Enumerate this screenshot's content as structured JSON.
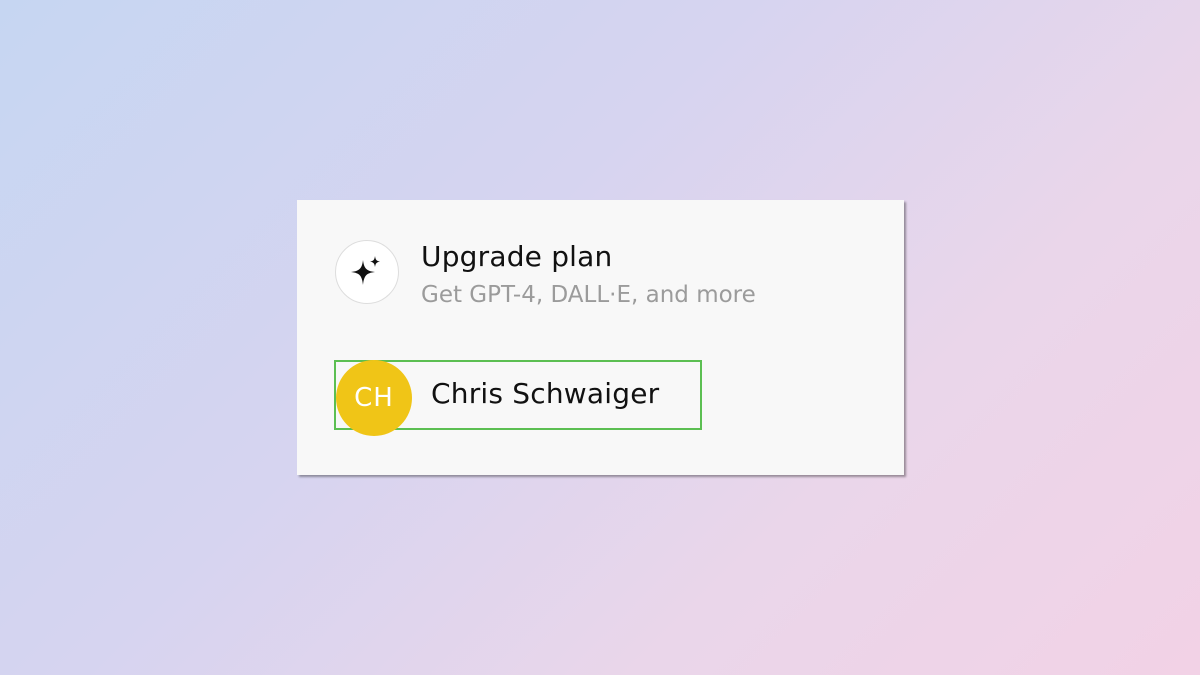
{
  "menu": {
    "upgrade": {
      "icon": "sparkles-icon",
      "title": "Upgrade plan",
      "subtitle": "Get GPT-4, DALL·E, and more"
    },
    "user": {
      "initials": "CH",
      "name": "Chris Schwaiger",
      "avatar_color": "#f0c517",
      "highlight_color": "#5cbf52"
    }
  }
}
